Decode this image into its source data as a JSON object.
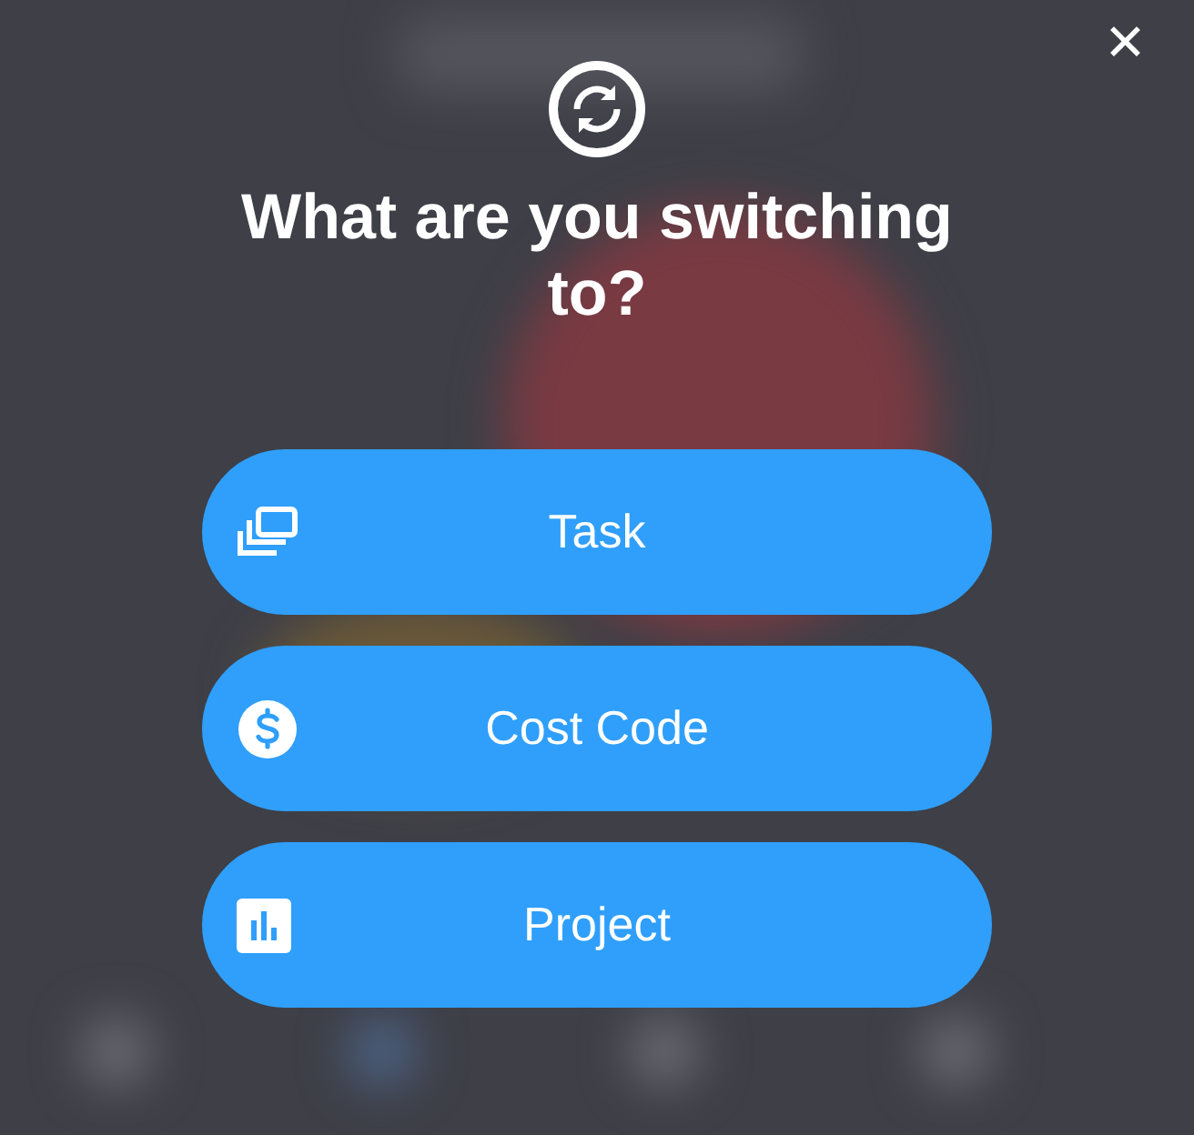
{
  "dialog": {
    "close_label": "✕",
    "title": "What are you switching to?",
    "options": [
      {
        "kind": "task",
        "label": "Task"
      },
      {
        "kind": "cost",
        "label": "Cost Code"
      },
      {
        "kind": "project",
        "label": "Project"
      }
    ]
  }
}
